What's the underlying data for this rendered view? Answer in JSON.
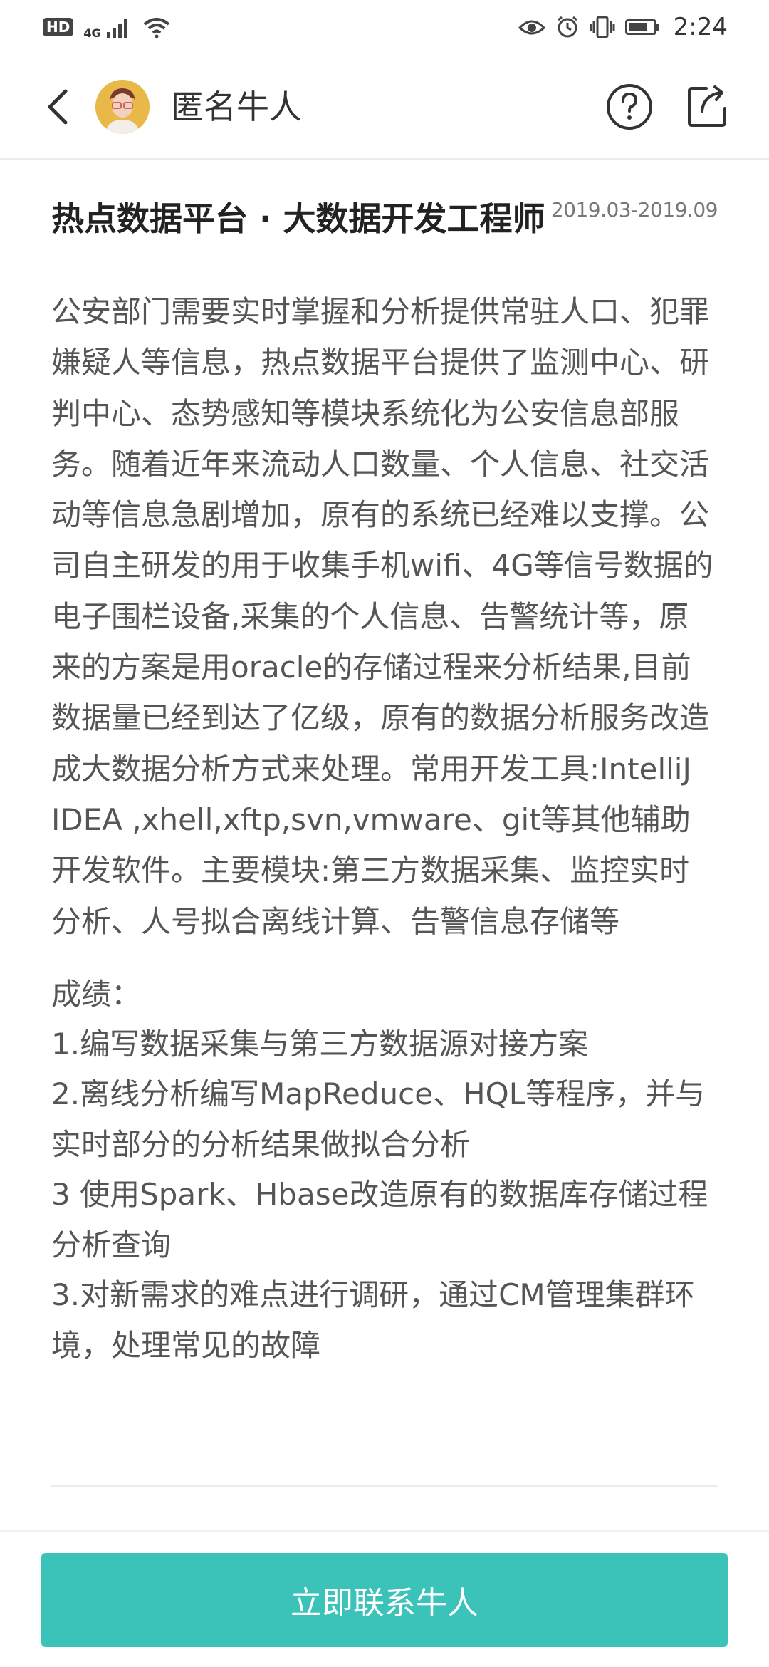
{
  "status_bar": {
    "hd": "HD",
    "network": "4G",
    "time": "2:24",
    "battery_level": 0.8
  },
  "header": {
    "title": "匿名牛人"
  },
  "project": {
    "title": "热点数据平台 · 大数据开发工程师",
    "period": "2019.03-2019.09",
    "description": "公安部门需要实时掌握和分析提供常驻人口、犯罪嫌疑人等信息，热点数据平台提供了监测中心、研判中心、态势感知等模块系统化为公安信息部服务。随着近年来流动人口数量、个人信息、社交活动等信息急剧增加，原有的系统已经难以支撑。公司自主研发的用于收集手机wifi、4G等信号数据的电子围栏设备,采集的个人信息、告警统计等，原来的方案是用oracle的存储过程来分析结果,目前数据量已经到达了亿级，原有的数据分析服务改造成大数据分析方式来处理。常用开发工具:IntelliJ IDEA ,xhell,xftp,svn,vmware、git等其他辅助开发软件。主要模块:第三方数据采集、监控实时分析、人号拟合离线计算、告警信息存储等",
    "achievements_label": "成绩：",
    "achievements": [
      "1.编写数据采集与第三方数据源对接方案",
      "2.离线分析编写MapReduce、HQL等程序，并与实时部分的分析结果做拟合分析",
      "3 使用Spark、Hbase改造原有的数据库存储过程分析查询",
      "3.对新需求的难点进行调研，通过CM管理集群环境，处理常见的故障"
    ]
  },
  "footer": {
    "contact_label": "立即联系牛人"
  },
  "colors": {
    "accent": "#3cc3b9",
    "text": "#555555",
    "title": "#222222"
  },
  "icons": [
    "hd-icon",
    "signal-icon",
    "wifi-icon",
    "eye-icon",
    "alarm-icon",
    "vibrate-icon",
    "battery-icon",
    "back-arrow-icon",
    "avatar-icon",
    "help-icon",
    "share-icon"
  ]
}
